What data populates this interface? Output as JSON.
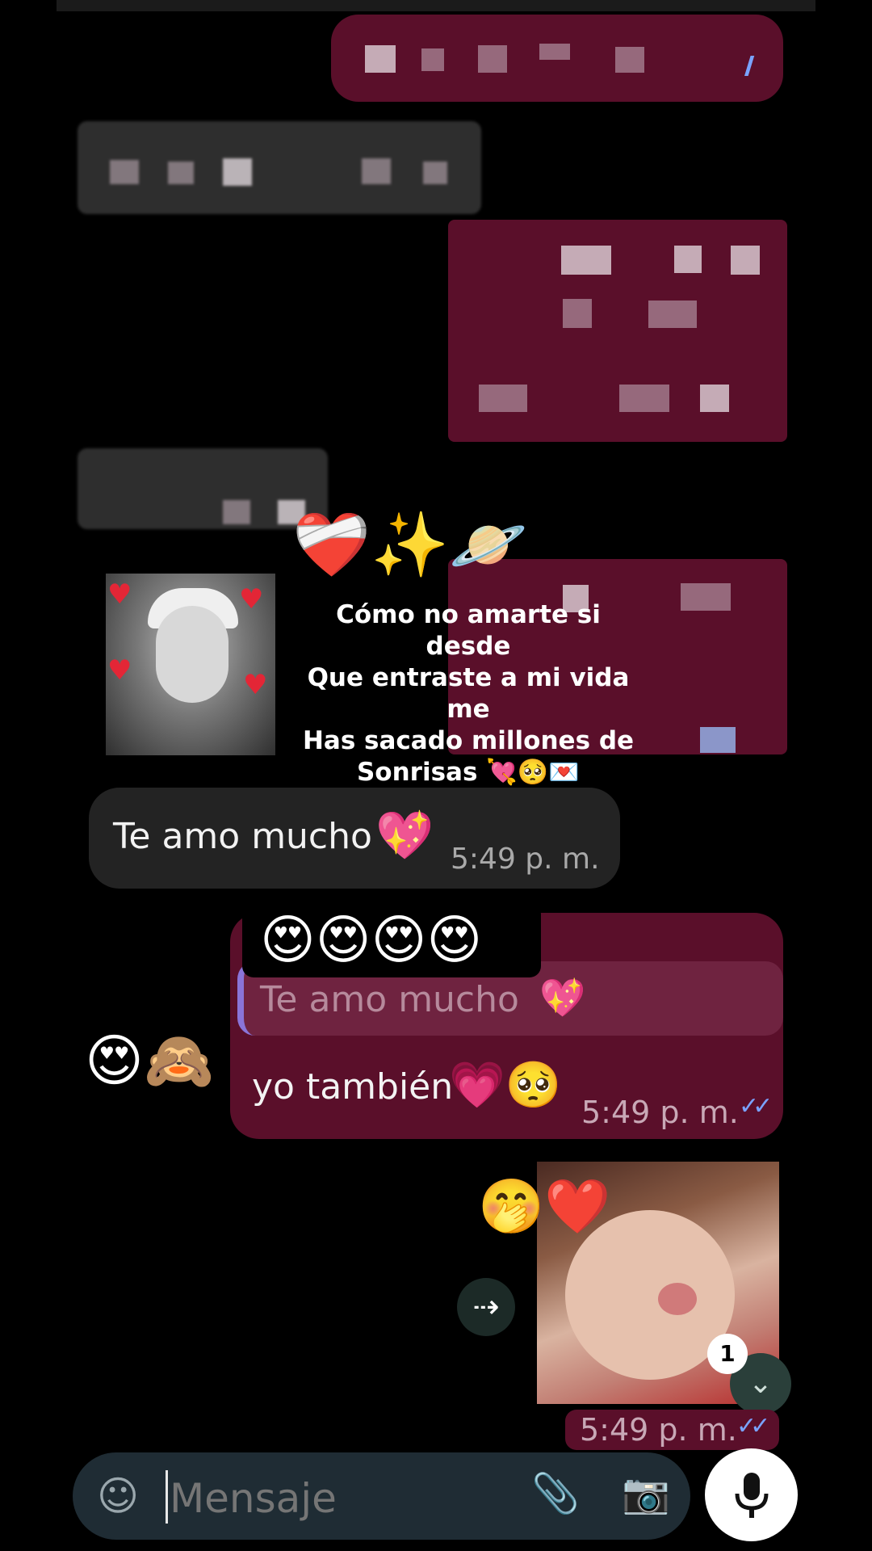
{
  "overlay": {
    "emojis": "❤️‍🩹✨🪐",
    "caption_lines": [
      "Cómo no amarte si desde",
      "Que entraste a mi vida me",
      "Has sacado millones de",
      "Sonrisas 💘🥺💌"
    ]
  },
  "messages": {
    "received": {
      "text": "Te amo mucho",
      "emoji": "💖",
      "time": "5:4⁠9 p. m."
    },
    "reply": {
      "sticker_emojis": "😍😍😍😍",
      "quoted_text": "Te amo mucho",
      "quoted_emoji": "💖",
      "text": "yo también",
      "emoji": "💗🥺",
      "time": "5:49 p. m.",
      "status": "✓✓"
    },
    "side_emojis": "😍🙈",
    "photo": {
      "emojis": "🤭❤️",
      "time": "5:49 p. m.",
      "status": "✓✓",
      "unread_count": "1"
    }
  },
  "input": {
    "placeholder": "Mensaje",
    "icons": {
      "sticker": "sticker-icon",
      "attach": "paperclip-icon",
      "camera": "camera-icon",
      "mic": "microphone-icon"
    }
  },
  "colors": {
    "sent_bubble": "#5a0f2a",
    "received_bubble": "#232323",
    "input_bar": "#1f2c34",
    "read_tick": "#7aa3ff"
  }
}
